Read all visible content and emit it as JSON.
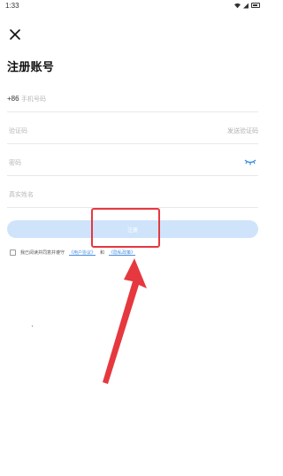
{
  "status": {
    "time": "1:33"
  },
  "header": {
    "title": "注册账号"
  },
  "form": {
    "phone": {
      "prefix": "+86",
      "placeholder": "手机号码"
    },
    "code": {
      "placeholder": "验证码",
      "send_label": "发送验证码"
    },
    "password": {
      "placeholder": "密码"
    },
    "realname": {
      "placeholder": "真实姓名"
    }
  },
  "register_button": {
    "label": "注册"
  },
  "agreement": {
    "text": "我已阅读并同意并遵守",
    "user_agreement": "《用户协议》",
    "and": "和",
    "privacy_policy": "《隐私政策》"
  },
  "colors": {
    "accent": "#4a90e2",
    "button_bg": "#cfe4fb",
    "annotation": "#e6383f"
  }
}
